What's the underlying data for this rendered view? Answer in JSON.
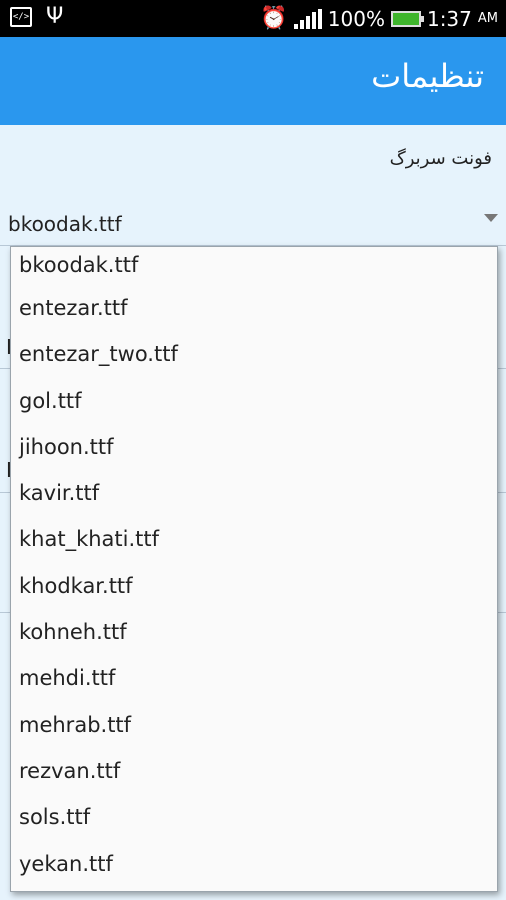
{
  "status_bar": {
    "battery_percent": "100%",
    "time": "1:37",
    "ampm": "AM"
  },
  "action_bar": {
    "title": "تنظیمات"
  },
  "preference": {
    "label": "فونت سربرگ"
  },
  "spinner": {
    "selected": "bkoodak.ttf"
  },
  "dropdown": {
    "options": [
      "bkoodak.ttf",
      "entezar.ttf",
      "entezar_two.ttf",
      "gol.ttf",
      "jihoon.ttf",
      "kavir.ttf",
      "khat_khati.ttf",
      "khodkar.ttf",
      "kohneh.ttf",
      "mehdi.ttf",
      "mehrab.ttf",
      "rezvan.ttf",
      "sols.ttf",
      "yekan.ttf"
    ]
  },
  "colors": {
    "accent": "#2a97ee",
    "background": "#e6f3fc",
    "status_bar": "#000000"
  }
}
